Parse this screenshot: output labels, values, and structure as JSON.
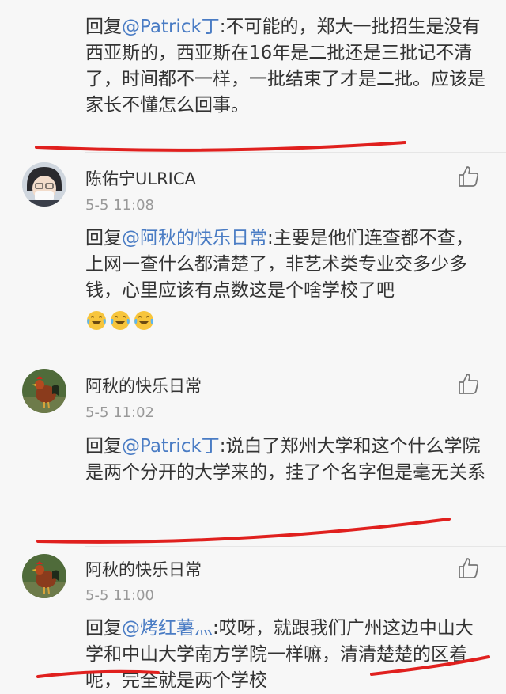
{
  "comments": [
    {
      "reply_prefix": "回复",
      "mention": "@Patrick丁",
      "text": ":不可能的，郑大一批招生是没有西亚斯的，西亚斯在16年是二批还是三批记不清了，时间都不一样，一批结束了才是二批。应该是家长不懂怎么回事。"
    },
    {
      "username": "陈佑宁ULRICA",
      "time": "5-5 11:08",
      "reply_prefix": "回复",
      "mention": "@阿秋的快乐日常",
      "text": ":主要是他们连查都不查，上网一查什么都清楚了，非艺术类专业交多少多钱，心里应该有点数这是个啥学校了吧",
      "emojis": [
        "laugh-cry",
        "laugh-cry",
        "laugh-cry"
      ]
    },
    {
      "username": "阿秋的快乐日常",
      "time": "5-5 11:02",
      "reply_prefix": "回复",
      "mention": "@Patrick丁",
      "text": ":说白了郑州大学和这个什么学院是两个分开的大学来的，挂了个名字但是毫无关系"
    },
    {
      "username": "阿秋的快乐日常",
      "time": "5-5 11:00",
      "reply_prefix": "回复",
      "mention": "@烤红薯灬",
      "text": ":哎呀，就跟我们广州这边中山大学和中山大学南方学院一样嘛，清清楚楚的区着呢，完全就是两个学校"
    }
  ],
  "icons": {
    "like": "thumbs-up-icon",
    "emoji": "laugh-cry-emoji"
  },
  "colors": {
    "mention": "#4a7cc4",
    "annotation": "#e0201e",
    "background": "#f7f7f7"
  }
}
